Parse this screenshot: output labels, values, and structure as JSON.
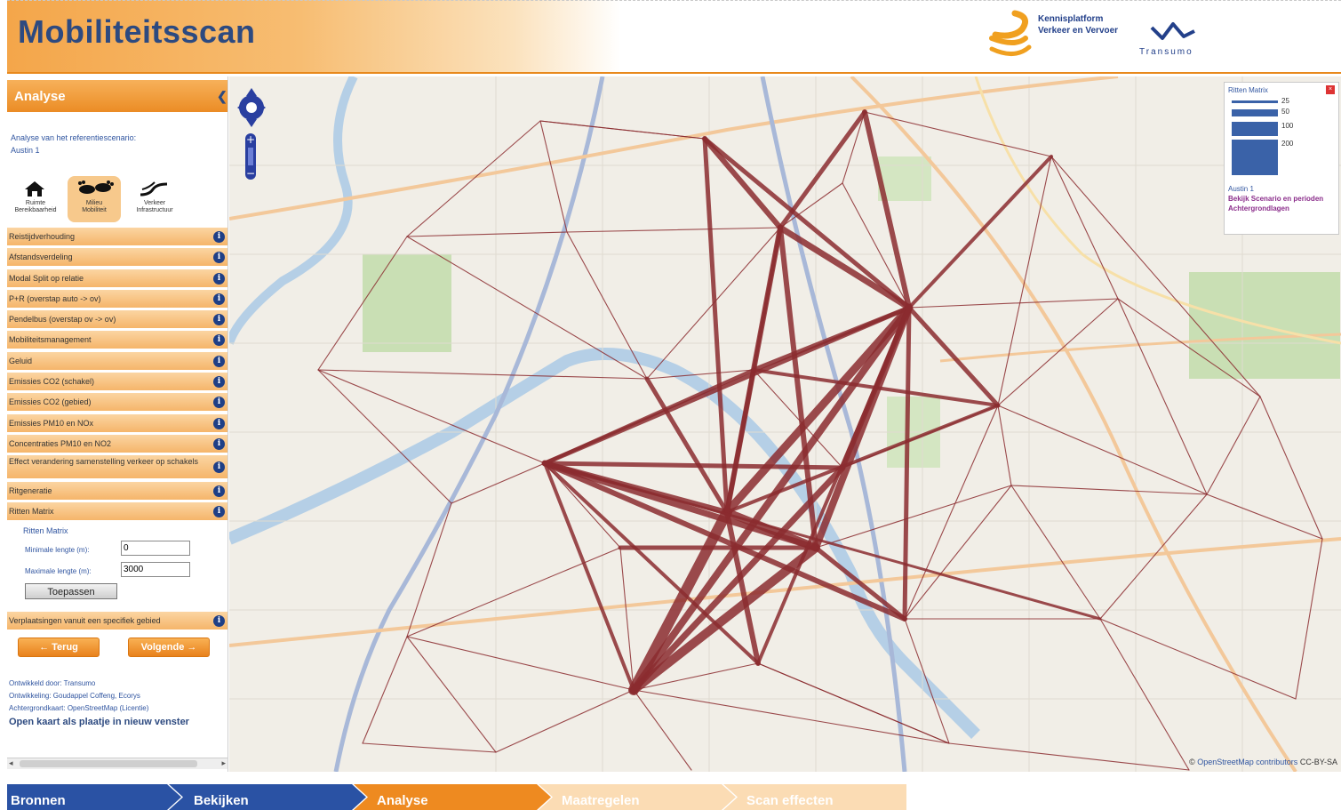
{
  "header": {
    "title": "Mobiliteitsscan",
    "partner1": "Kennisplatform\nVerkeer en Vervoer",
    "partner2": "Transumo"
  },
  "panel": {
    "heading": "Analyse",
    "intro_line1": "Analyse van het referentiescenario:",
    "intro_line2": "Austin 1",
    "themes": [
      {
        "label": "Ruimte\nBereikbaarheid",
        "icon": "house-car-icon"
      },
      {
        "label": "Milieu\nMobiliteit",
        "icon": "footprints-icon"
      },
      {
        "label": "Verkeer\nInfrastructuur",
        "icon": "road-icon"
      }
    ],
    "menu": [
      "Reistijdverhouding",
      "Afstandsverdeling",
      "Modal Split op relatie",
      "P+R (overstap auto -> ov)",
      "Pendelbus (overstap ov -> ov)",
      "Mobiliteitsmanagement",
      "Geluid",
      "Emissies CO2 (schakel)",
      "Emissies CO2 (gebied)",
      "Emissies PM10 en NOx",
      "Concentraties PM10 en NO2",
      "Effect verandering samenstelling verkeer op schakels",
      "Ritgeneratie",
      "Ritten Matrix"
    ],
    "ritten_form": {
      "title": "Ritten Matrix",
      "min_label": "Minimale lengte (m):",
      "min_value": "0",
      "max_label": "Maximale lengte (m):",
      "max_value": "3000",
      "apply": "Toepassen"
    },
    "verplaatsingen": "Verplaatsingen vanuit een specifiek gebied",
    "back_button": "← Terug",
    "next_button": "Volgende →",
    "credits": [
      "Ontwikkeld door: Transumo",
      "Ontwikkeling: Goudappel Coffeng, Ecorys",
      "Achtergrondkaart: OpenStreetMap (Licentie)"
    ],
    "open_link": "Open kaart als plaatje in nieuw venster"
  },
  "map": {
    "legend": {
      "title": "Ritten Matrix",
      "values": [
        "25",
        "50",
        "100",
        "200"
      ],
      "scenario": "Austin 1",
      "link1": "Bekijk Scenario en perioden",
      "link2": "Achtergrondlagen"
    },
    "attribution_prefix": "© ",
    "attribution_link": "OpenStreetMap contributors",
    "attribution_suffix": " CC-BY-SA",
    "flow_color": "#8b2b2f"
  },
  "steps": [
    {
      "label": "Bronnen",
      "state": "done",
      "color": "#2a52a4"
    },
    {
      "label": "Bekijken",
      "state": "done",
      "color": "#2a52a4"
    },
    {
      "label": "Analyse",
      "state": "active",
      "color": "#ee8a20"
    },
    {
      "label": "Maatregelen",
      "state": "todo",
      "color": "#fbdcb4"
    },
    {
      "label": "Scan effecten",
      "state": "todo",
      "color": "#fbdcb4"
    }
  ]
}
